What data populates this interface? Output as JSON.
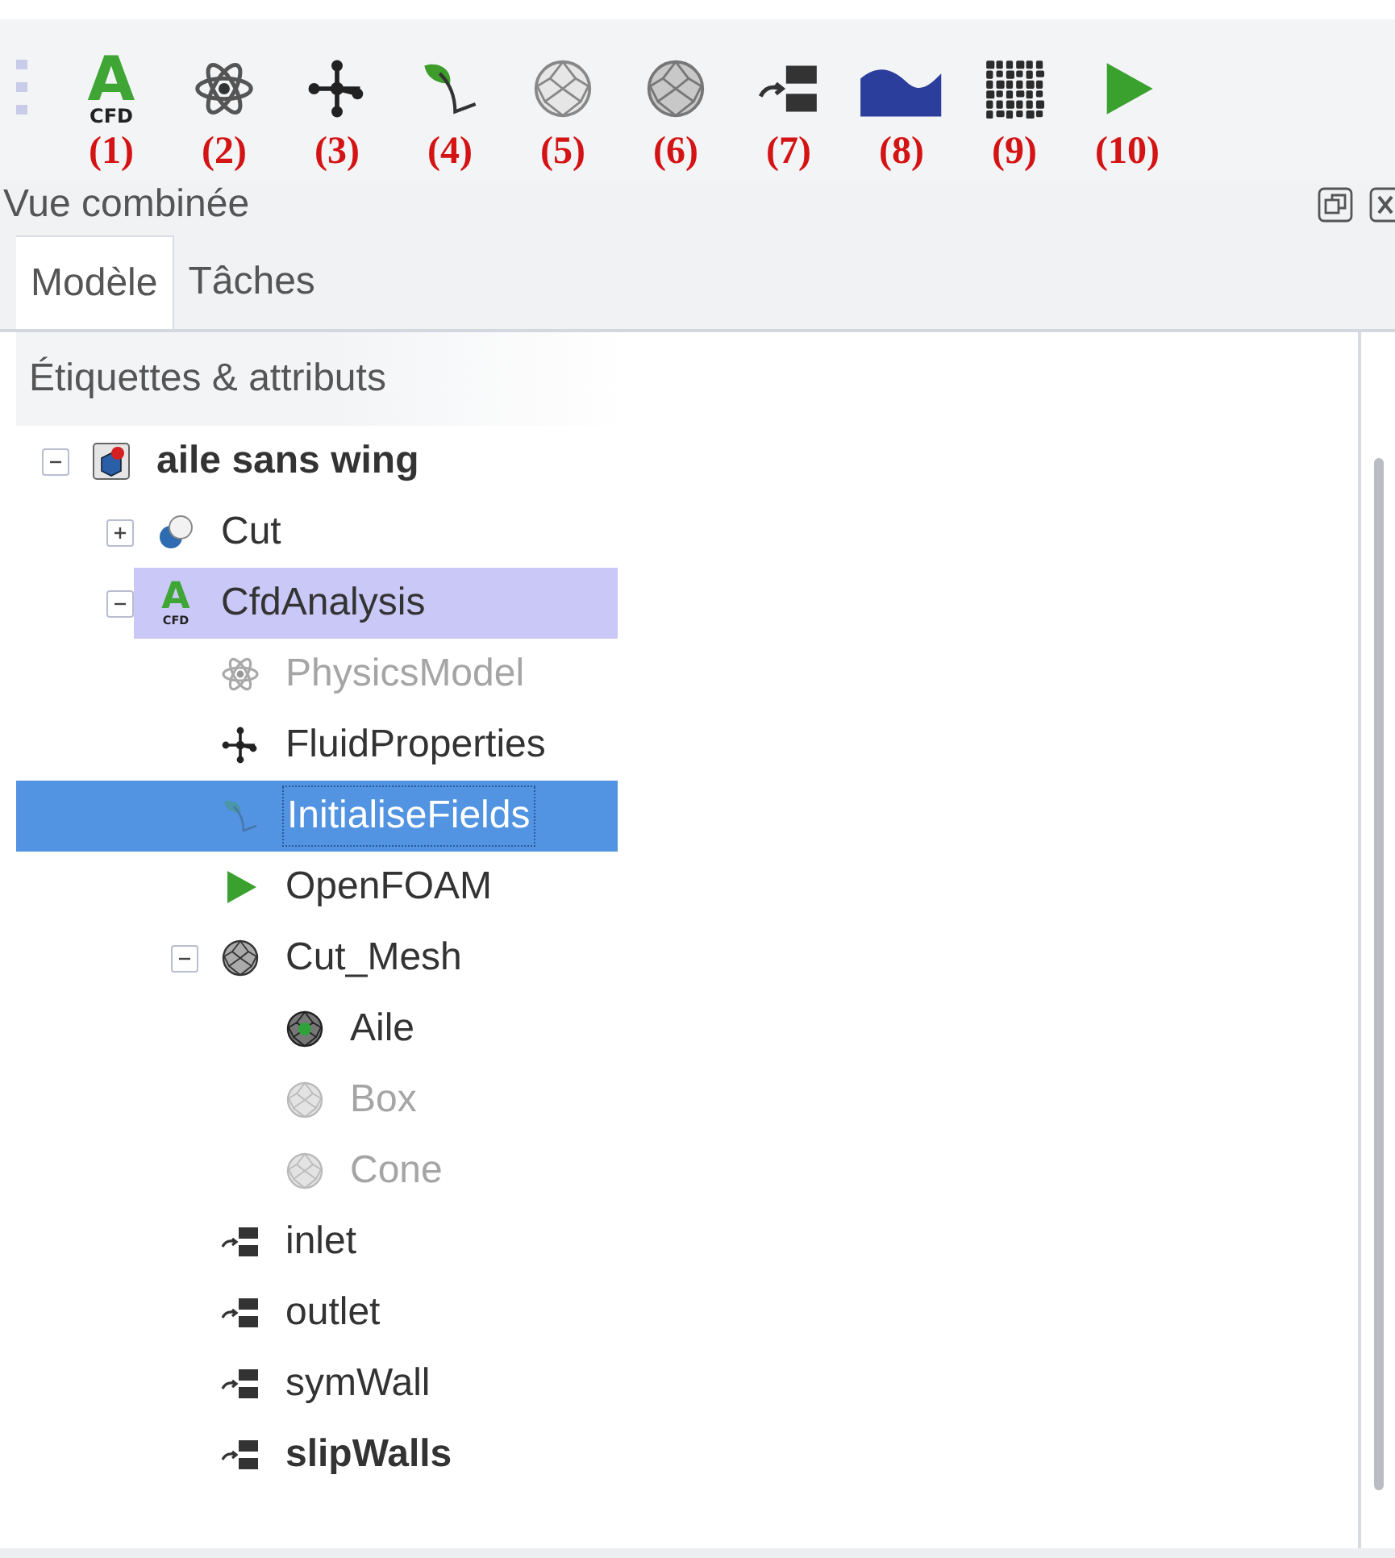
{
  "toolbar": {
    "buttons": [
      {
        "kind": "cfd",
        "icon_text": "A",
        "icon_caption": "CFD",
        "label": "(1)"
      },
      {
        "kind": "atom",
        "label": "(2)"
      },
      {
        "kind": "network",
        "label": "(3)"
      },
      {
        "kind": "sprout",
        "label": "(4)"
      },
      {
        "kind": "sphere",
        "label": "(5)"
      },
      {
        "kind": "sphere-dense",
        "label": "(6)"
      },
      {
        "kind": "boundary",
        "label": "(7)"
      },
      {
        "kind": "wave",
        "label": "(8)"
      },
      {
        "kind": "mesh",
        "label": "(9)"
      },
      {
        "kind": "play",
        "label": "(10)"
      }
    ]
  },
  "panel": {
    "title": "Vue combinée",
    "tabs": [
      {
        "label": "Modèle",
        "selected": true
      },
      {
        "label": "Tâches",
        "selected": false
      }
    ],
    "header": "Étiquettes & attributs",
    "tree": [
      {
        "label": "aile sans wing",
        "kind": "part",
        "expanded": true,
        "selected": false,
        "highlighted": false,
        "disabled": false,
        "bold": true,
        "children": [
          {
            "label": "Cut",
            "kind": "cut",
            "expanded": false,
            "selected": false,
            "highlighted": false,
            "disabled": false,
            "bold": false
          },
          {
            "label": "CfdAnalysis",
            "kind": "cfd",
            "icon_text": "A",
            "icon_caption": "CFD",
            "expanded": true,
            "selected": false,
            "highlighted": true,
            "disabled": false,
            "bold": false,
            "children": [
              {
                "label": "PhysicsModel",
                "kind": "atom",
                "selected": false,
                "highlighted": false,
                "disabled": true,
                "bold": false
              },
              {
                "label": "FluidProperties",
                "kind": "network",
                "selected": false,
                "highlighted": false,
                "disabled": false,
                "bold": false
              },
              {
                "label": "InitialiseFields",
                "kind": "sprout",
                "selected": true,
                "highlighted": false,
                "disabled": false,
                "bold": false
              },
              {
                "label": "OpenFOAM",
                "kind": "play",
                "selected": false,
                "highlighted": false,
                "disabled": false,
                "bold": false
              },
              {
                "label": "Cut_Mesh",
                "kind": "sphere-dark",
                "expanded": true,
                "selected": false,
                "highlighted": false,
                "disabled": false,
                "bold": false,
                "children": [
                  {
                    "label": "Aile",
                    "kind": "sphere-green",
                    "selected": false,
                    "highlighted": false,
                    "disabled": false,
                    "bold": false
                  },
                  {
                    "label": "Box",
                    "kind": "sphere-dense",
                    "selected": false,
                    "highlighted": false,
                    "disabled": true,
                    "bold": false
                  },
                  {
                    "label": "Cone",
                    "kind": "sphere-dense",
                    "selected": false,
                    "highlighted": false,
                    "disabled": true,
                    "bold": false
                  }
                ]
              },
              {
                "label": "inlet",
                "kind": "boundary",
                "selected": false,
                "highlighted": false,
                "disabled": false,
                "bold": false
              },
              {
                "label": "outlet",
                "kind": "boundary",
                "selected": false,
                "highlighted": false,
                "disabled": false,
                "bold": false
              },
              {
                "label": "symWall",
                "kind": "boundary",
                "selected": false,
                "highlighted": false,
                "disabled": false,
                "bold": false
              },
              {
                "label": "slipWalls",
                "kind": "boundary",
                "selected": false,
                "highlighted": false,
                "disabled": false,
                "bold": true
              }
            ]
          }
        ]
      }
    ]
  }
}
